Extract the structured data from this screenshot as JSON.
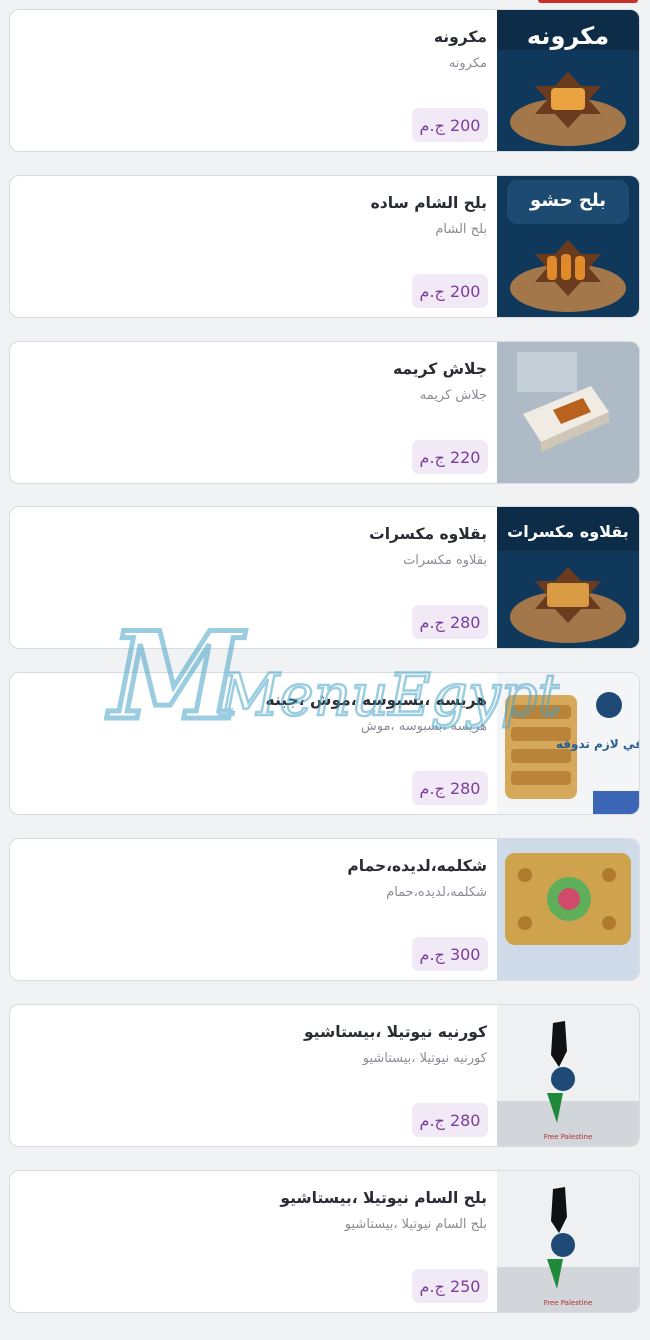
{
  "currency": "ج.م",
  "watermark_text": "MenuEgypt.com",
  "items": [
    {
      "title": "مكرونه",
      "description": "مكرونه",
      "price": "200 ج.م",
      "image_label": "مكرونه"
    },
    {
      "title": "بلح الشام ساده",
      "description": "بلح الشام",
      "price": "200 ج.م",
      "image_label": "بلح حشو"
    },
    {
      "title": "جلاش كريمه",
      "description": "جلاش كريمه",
      "price": "220 ج.م",
      "image_label": ""
    },
    {
      "title": "بقلاوه مكسرات",
      "description": "بقلاوه مكسرات",
      "price": "280 ج.م",
      "image_label": "بقلاوه مكسرات"
    },
    {
      "title": "هريسه ،بسبوسه ،موش ،جبنه",
      "description": "هريسه ،بسبوسه ،موش",
      "price": "280 ج.م",
      "image_label": "شرقي لازم تدوقه"
    },
    {
      "title": "شكلمه،لديده،حمام",
      "description": "شكلمه،لديده،حمام",
      "price": "300 ج.م",
      "image_label": ""
    },
    {
      "title": "كورنيه نيوتيلا ،بيستاشيو",
      "description": "كورنيه نيوتيلا ،بيستاشيو",
      "price": "280 ج.م",
      "image_label": "Free Palestine"
    },
    {
      "title": "بلح السام نيوتيلا ،بيستاشيو",
      "description": "بلح السام نيوتيلا ،بيستاشيو",
      "price": "250 ج.م",
      "image_label": "Free Palestine"
    }
  ]
}
